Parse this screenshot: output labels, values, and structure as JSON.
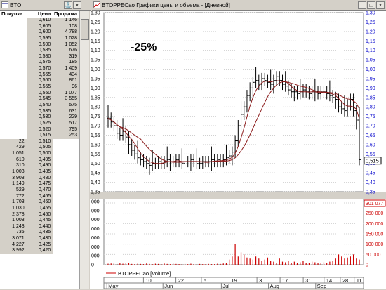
{
  "book_window": {
    "title": "BTO",
    "icon": "window-icon",
    "headers": {
      "bid": "Покупка",
      "price": "Цена",
      "ask": "Продажа"
    }
  },
  "asks": [
    {
      "price": "0,610",
      "vol": "1 146"
    },
    {
      "price": "0,605",
      "vol": "108"
    },
    {
      "price": "0,600",
      "vol": "4 788"
    },
    {
      "price": "0,595",
      "vol": "1 028"
    },
    {
      "price": "0,590",
      "vol": "1 052"
    },
    {
      "price": "0,585",
      "vol": "676"
    },
    {
      "price": "0,580",
      "vol": "319"
    },
    {
      "price": "0,575",
      "vol": "185"
    },
    {
      "price": "0,570",
      "vol": "1 409"
    },
    {
      "price": "0,565",
      "vol": "434"
    },
    {
      "price": "0,560",
      "vol": "861"
    },
    {
      "price": "0,555",
      "vol": "96"
    },
    {
      "price": "0,550",
      "vol": "1 077"
    },
    {
      "price": "0,545",
      "vol": "3 555"
    },
    {
      "price": "0,540",
      "vol": "575"
    },
    {
      "price": "0,535",
      "vol": "631"
    },
    {
      "price": "0,530",
      "vol": "229"
    },
    {
      "price": "0,525",
      "vol": "517"
    },
    {
      "price": "0,520",
      "vol": "795"
    },
    {
      "price": "0,515",
      "vol": "253"
    }
  ],
  "bids": [
    {
      "vol": "22",
      "price": "0,510"
    },
    {
      "vol": "429",
      "price": "0,505"
    },
    {
      "vol": "1 051",
      "price": "0,500"
    },
    {
      "vol": "610",
      "price": "0,495"
    },
    {
      "vol": "310",
      "price": "0,490"
    },
    {
      "vol": "1 003",
      "price": "0,485"
    },
    {
      "vol": "3 903",
      "price": "0,480"
    },
    {
      "vol": "1 149",
      "price": "0,475"
    },
    {
      "vol": "529",
      "price": "0,470"
    },
    {
      "vol": "772",
      "price": "0,465"
    },
    {
      "vol": "1 703",
      "price": "0,460"
    },
    {
      "vol": "1 030",
      "price": "0,455"
    },
    {
      "vol": "2 378",
      "price": "0,450"
    },
    {
      "vol": "1 003",
      "price": "0,445"
    },
    {
      "vol": "1 243",
      "price": "0,440"
    },
    {
      "vol": "735",
      "price": "0,435"
    },
    {
      "vol": "3 071",
      "price": "0,430"
    },
    {
      "vol": "4 227",
      "price": "0,425"
    },
    {
      "vol": "3 992",
      "price": "0,420"
    }
  ],
  "chart_window": {
    "title": "BTOPPECao Графики цены и объема - [Дневной]",
    "annotation": "-25%",
    "last_price": "0,515",
    "last_volume": "301 077",
    "legend": "BTOPPECao [Volume]",
    "colors": {
      "price": "#000000",
      "ma_fast": "#8b1a1a",
      "ma_slow": "#8b1a1a",
      "volume": "#cc0000",
      "axis": "#0000cc"
    }
  },
  "chart_data": {
    "type": "candlestick",
    "price_axis_left": [
      "1,30",
      "1,25",
      "1,20",
      "1,15",
      "1,10",
      "1,05",
      "1,00",
      "1,95",
      "1,90",
      "1,85",
      "1,80",
      "1,75",
      "1,70",
      "1,65",
      "1,60",
      "1,55",
      "1,50",
      "1,45",
      "1,40",
      "1,35"
    ],
    "price_axis_right": [
      "1,30",
      "1,25",
      "1,20",
      "1,15",
      "1,10",
      "1,05",
      "1,00",
      "0,95",
      "0,90",
      "0,85",
      "0,80",
      "0,75",
      "0,70",
      "0,65",
      "0,60",
      "0,55",
      "0,50",
      "0,45",
      "0,40",
      "0,35"
    ],
    "ylim": [
      0.35,
      1.3
    ],
    "volume_axis_left": [
      "000",
      "000",
      "000",
      "000",
      "000",
      "000",
      "000",
      "0"
    ],
    "volume_axis_right": [
      "300 000",
      "250 000",
      "200 000",
      "150 000",
      "100 000",
      "50 000",
      "0"
    ],
    "volume_ylim": [
      0,
      300000
    ],
    "x_day_labels": [
      "10",
      "22",
      "5",
      "19",
      "3",
      "17",
      "31",
      "14",
      "28",
      "11"
    ],
    "x_month_labels": [
      "May",
      "Jun",
      "Jul",
      "Aug",
      "Sep"
    ],
    "close": [
      0.74,
      0.72,
      0.7,
      0.66,
      0.65,
      0.67,
      0.64,
      0.6,
      0.57,
      0.55,
      0.53,
      0.52,
      0.51,
      0.5,
      0.49,
      0.5,
      0.5,
      0.51,
      0.5,
      0.51,
      0.52,
      0.51,
      0.51,
      0.52,
      0.51,
      0.5,
      0.51,
      0.51,
      0.52,
      0.51,
      0.5,
      0.5,
      0.51,
      0.51,
      0.51,
      0.52,
      0.51,
      0.52,
      0.51,
      0.52,
      0.53,
      0.54,
      0.56,
      0.62,
      0.7,
      0.76,
      0.8,
      0.86,
      0.9,
      0.93,
      0.94,
      0.92,
      0.95,
      0.94,
      0.93,
      0.92,
      0.94,
      0.96,
      0.94,
      0.92,
      0.91,
      0.89,
      0.88,
      0.88,
      0.87,
      0.88,
      0.89,
      0.88,
      0.87,
      0.88,
      0.88,
      0.87,
      0.88,
      0.88,
      0.87,
      0.86,
      0.85,
      0.84,
      0.8,
      0.79,
      0.78,
      0.81,
      0.84,
      0.78,
      0.73,
      0.52
    ],
    "volume": [
      5000,
      6000,
      7000,
      4000,
      8000,
      5000,
      6000,
      9000,
      4000,
      3000,
      5000,
      4000,
      3000,
      6000,
      4000,
      3000,
      5000,
      4000,
      3000,
      6000,
      4000,
      3000,
      5000,
      4000,
      3000,
      3000,
      4000,
      3000,
      5000,
      3000,
      2000,
      4000,
      3000,
      3000,
      4000,
      3000,
      3000,
      5000,
      4000,
      6000,
      10000,
      25000,
      40000,
      100000,
      40000,
      60000,
      50000,
      35000,
      30000,
      25000,
      40000,
      30000,
      20000,
      25000,
      35000,
      20000,
      15000,
      10000,
      30000,
      15000,
      12000,
      20000,
      10000,
      15000,
      8000,
      12000,
      20000,
      10000,
      8000,
      15000,
      12000,
      10000,
      8000,
      12000,
      10000,
      15000,
      20000,
      30000,
      50000,
      40000,
      30000,
      35000,
      40000,
      50000,
      30000,
      25000
    ]
  }
}
